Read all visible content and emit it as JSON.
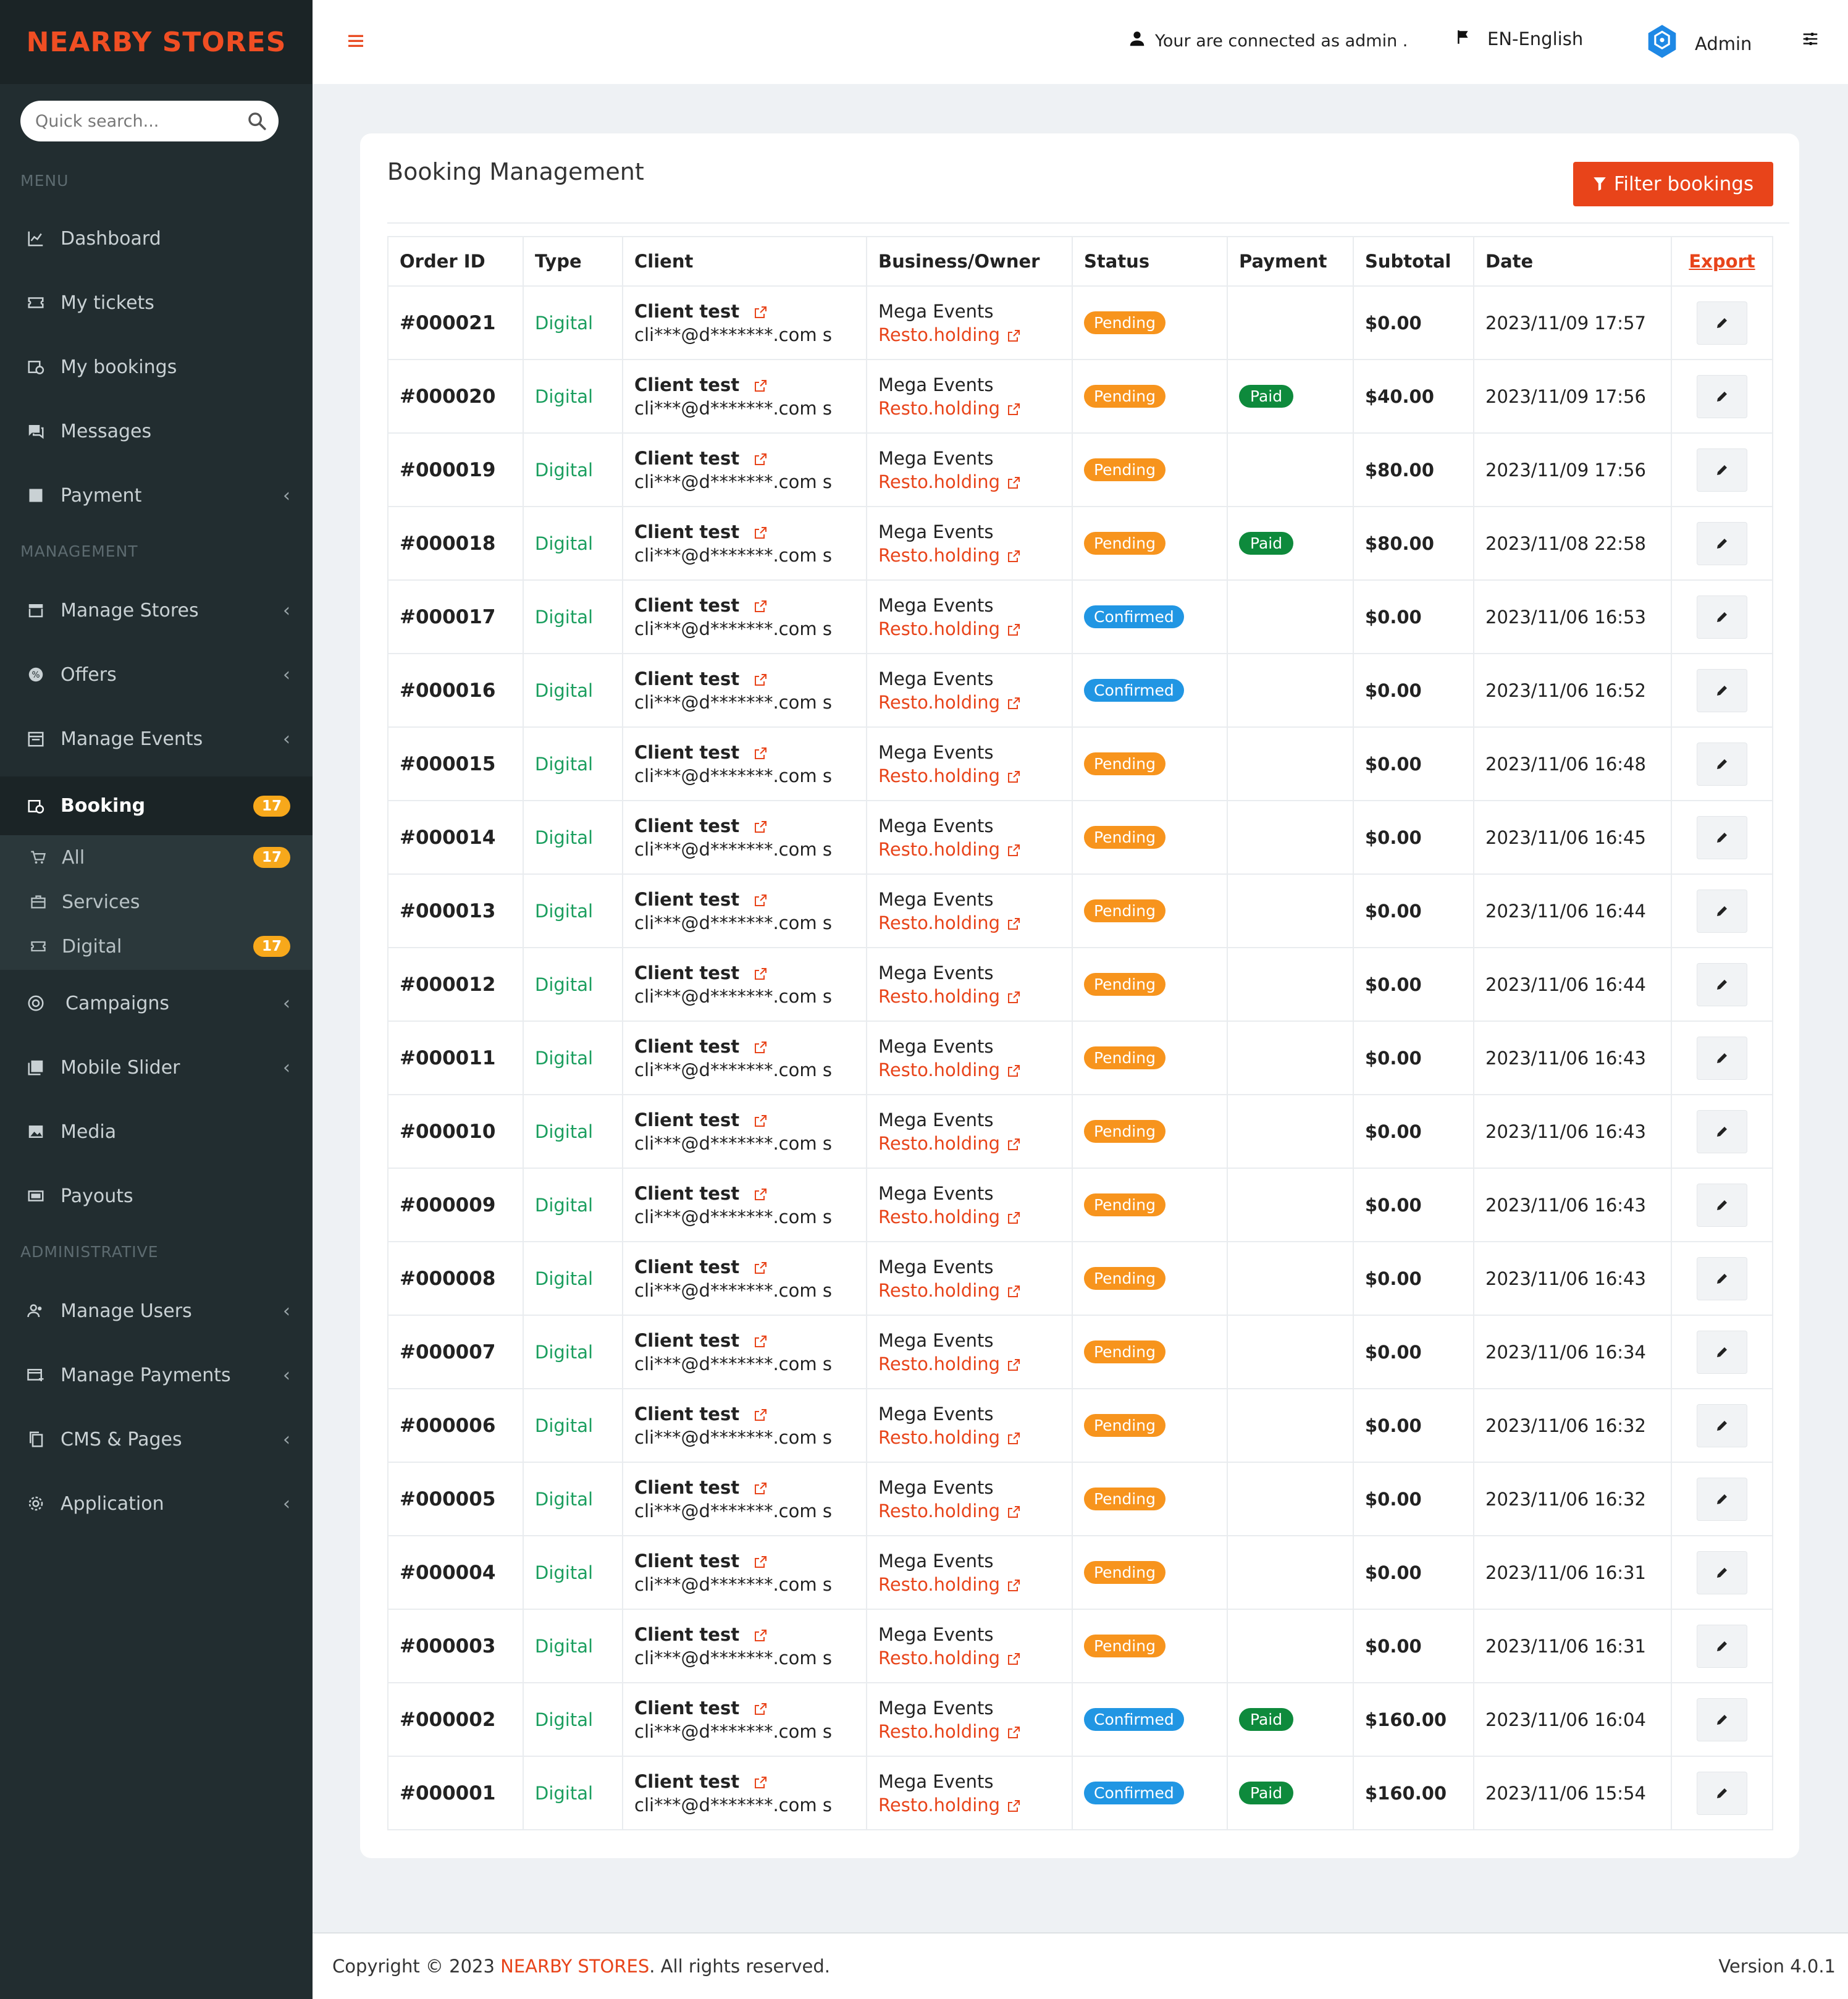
{
  "brand": "NEARBY STORES",
  "search": {
    "placeholder": "Quick search..."
  },
  "sections": {
    "menu": "MENU",
    "management": "MANAGEMENT",
    "administrative": "ADMINISTRATIVE"
  },
  "nav": {
    "dashboard": "Dashboard",
    "my_tickets": "My tickets",
    "my_bookings": "My bookings",
    "messages": "Messages",
    "payment": "Payment",
    "manage_stores": "Manage Stores",
    "offers": "Offers",
    "manage_events": "Manage Events",
    "booking": "Booking",
    "booking_count": "17",
    "sub_all": "All",
    "sub_all_count": "17",
    "sub_services": "Services",
    "sub_digital": "Digital",
    "sub_digital_count": "17",
    "campaigns": "Campaigns",
    "mobile_slider": "Mobile Slider",
    "media": "Media",
    "payouts": "Payouts",
    "manage_users": "Manage Users",
    "manage_payments": "Manage Payments",
    "cms_pages": "CMS & Pages",
    "application": "Application"
  },
  "topbar": {
    "connected": "Your are connected as admin .",
    "language": "EN-English",
    "admin": "Admin"
  },
  "page": {
    "title": "Booking Management",
    "filter_label": "Filter bookings"
  },
  "table": {
    "headers": [
      "Order ID",
      "Type",
      "Client",
      "Business/Owner",
      "Status",
      "Payment",
      "Subtotal",
      "Date",
      "Export"
    ],
    "rows": [
      {
        "id": "#000021",
        "type": "Digital",
        "client": "Client test",
        "email": "cli***@d*******.com s",
        "business": "Mega Events",
        "owner": "Resto.holding",
        "status": "Pending",
        "payment": "",
        "subtotal": "$0.00",
        "date": "2023/11/09 17:57"
      },
      {
        "id": "#000020",
        "type": "Digital",
        "client": "Client test",
        "email": "cli***@d*******.com s",
        "business": "Mega Events",
        "owner": "Resto.holding",
        "status": "Pending",
        "payment": "Paid",
        "subtotal": "$40.00",
        "date": "2023/11/09 17:56"
      },
      {
        "id": "#000019",
        "type": "Digital",
        "client": "Client test",
        "email": "cli***@d*******.com s",
        "business": "Mega Events",
        "owner": "Resto.holding",
        "status": "Pending",
        "payment": "",
        "subtotal": "$80.00",
        "date": "2023/11/09 17:56"
      },
      {
        "id": "#000018",
        "type": "Digital",
        "client": "Client test",
        "email": "cli***@d*******.com s",
        "business": "Mega Events",
        "owner": "Resto.holding",
        "status": "Pending",
        "payment": "Paid",
        "subtotal": "$80.00",
        "date": "2023/11/08 22:58"
      },
      {
        "id": "#000017",
        "type": "Digital",
        "client": "Client test",
        "email": "cli***@d*******.com s",
        "business": "Mega Events",
        "owner": "Resto.holding",
        "status": "Confirmed",
        "payment": "",
        "subtotal": "$0.00",
        "date": "2023/11/06 16:53"
      },
      {
        "id": "#000016",
        "type": "Digital",
        "client": "Client test",
        "email": "cli***@d*******.com s",
        "business": "Mega Events",
        "owner": "Resto.holding",
        "status": "Confirmed",
        "payment": "",
        "subtotal": "$0.00",
        "date": "2023/11/06 16:52"
      },
      {
        "id": "#000015",
        "type": "Digital",
        "client": "Client test",
        "email": "cli***@d*******.com s",
        "business": "Mega Events",
        "owner": "Resto.holding",
        "status": "Pending",
        "payment": "",
        "subtotal": "$0.00",
        "date": "2023/11/06 16:48"
      },
      {
        "id": "#000014",
        "type": "Digital",
        "client": "Client test",
        "email": "cli***@d*******.com s",
        "business": "Mega Events",
        "owner": "Resto.holding",
        "status": "Pending",
        "payment": "",
        "subtotal": "$0.00",
        "date": "2023/11/06 16:45"
      },
      {
        "id": "#000013",
        "type": "Digital",
        "client": "Client test",
        "email": "cli***@d*******.com s",
        "business": "Mega Events",
        "owner": "Resto.holding",
        "status": "Pending",
        "payment": "",
        "subtotal": "$0.00",
        "date": "2023/11/06 16:44"
      },
      {
        "id": "#000012",
        "type": "Digital",
        "client": "Client test",
        "email": "cli***@d*******.com s",
        "business": "Mega Events",
        "owner": "Resto.holding",
        "status": "Pending",
        "payment": "",
        "subtotal": "$0.00",
        "date": "2023/11/06 16:44"
      },
      {
        "id": "#000011",
        "type": "Digital",
        "client": "Client test",
        "email": "cli***@d*******.com s",
        "business": "Mega Events",
        "owner": "Resto.holding",
        "status": "Pending",
        "payment": "",
        "subtotal": "$0.00",
        "date": "2023/11/06 16:43"
      },
      {
        "id": "#000010",
        "type": "Digital",
        "client": "Client test",
        "email": "cli***@d*******.com s",
        "business": "Mega Events",
        "owner": "Resto.holding",
        "status": "Pending",
        "payment": "",
        "subtotal": "$0.00",
        "date": "2023/11/06 16:43"
      },
      {
        "id": "#000009",
        "type": "Digital",
        "client": "Client test",
        "email": "cli***@d*******.com s",
        "business": "Mega Events",
        "owner": "Resto.holding",
        "status": "Pending",
        "payment": "",
        "subtotal": "$0.00",
        "date": "2023/11/06 16:43"
      },
      {
        "id": "#000008",
        "type": "Digital",
        "client": "Client test",
        "email": "cli***@d*******.com s",
        "business": "Mega Events",
        "owner": "Resto.holding",
        "status": "Pending",
        "payment": "",
        "subtotal": "$0.00",
        "date": "2023/11/06 16:43"
      },
      {
        "id": "#000007",
        "type": "Digital",
        "client": "Client test",
        "email": "cli***@d*******.com s",
        "business": "Mega Events",
        "owner": "Resto.holding",
        "status": "Pending",
        "payment": "",
        "subtotal": "$0.00",
        "date": "2023/11/06 16:34"
      },
      {
        "id": "#000006",
        "type": "Digital",
        "client": "Client test",
        "email": "cli***@d*******.com s",
        "business": "Mega Events",
        "owner": "Resto.holding",
        "status": "Pending",
        "payment": "",
        "subtotal": "$0.00",
        "date": "2023/11/06 16:32"
      },
      {
        "id": "#000005",
        "type": "Digital",
        "client": "Client test",
        "email": "cli***@d*******.com s",
        "business": "Mega Events",
        "owner": "Resto.holding",
        "status": "Pending",
        "payment": "",
        "subtotal": "$0.00",
        "date": "2023/11/06 16:32"
      },
      {
        "id": "#000004",
        "type": "Digital",
        "client": "Client test",
        "email": "cli***@d*******.com s",
        "business": "Mega Events",
        "owner": "Resto.holding",
        "status": "Pending",
        "payment": "",
        "subtotal": "$0.00",
        "date": "2023/11/06 16:31"
      },
      {
        "id": "#000003",
        "type": "Digital",
        "client": "Client test",
        "email": "cli***@d*******.com s",
        "business": "Mega Events",
        "owner": "Resto.holding",
        "status": "Pending",
        "payment": "",
        "subtotal": "$0.00",
        "date": "2023/11/06 16:31"
      },
      {
        "id": "#000002",
        "type": "Digital",
        "client": "Client test",
        "email": "cli***@d*******.com s",
        "business": "Mega Events",
        "owner": "Resto.holding",
        "status": "Confirmed",
        "payment": "Paid",
        "subtotal": "$160.00",
        "date": "2023/11/06 16:04"
      },
      {
        "id": "#000001",
        "type": "Digital",
        "client": "Client test",
        "email": "cli***@d*******.com s",
        "business": "Mega Events",
        "owner": "Resto.holding",
        "status": "Confirmed",
        "payment": "Paid",
        "subtotal": "$160.00",
        "date": "2023/11/06 15:54"
      }
    ]
  },
  "footer": {
    "copy_prefix": "Copyright © 2023 ",
    "copy_brand": "NEARBY STORES",
    "copy_suffix": ". All rights reserved.",
    "version": "Version 4.0.1"
  },
  "colors": {
    "accent": "#e8441a",
    "sidebar": "#222d30",
    "pending": "#f7941d",
    "confirmed": "#2196e3",
    "paid": "#0e8a3c",
    "digital": "#1a9e5e"
  }
}
